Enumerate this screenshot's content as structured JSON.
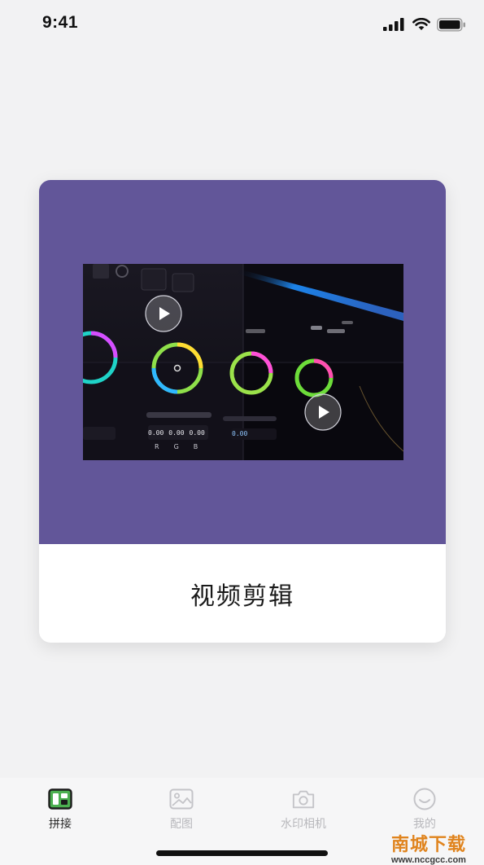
{
  "status_bar": {
    "time": "9:41"
  },
  "card": {
    "title": "视频剪辑",
    "banner_color": "#625699",
    "preview": {
      "wheel_labels": [
        "0.00",
        "0.00",
        "0.00",
        "0.00",
        "R",
        "G",
        "B"
      ]
    }
  },
  "tabs": [
    {
      "label": "拼接",
      "icon": "collage-icon",
      "active": true
    },
    {
      "label": "配图",
      "icon": "image-icon",
      "active": false
    },
    {
      "label": "水印相机",
      "icon": "camera-icon",
      "active": false
    },
    {
      "label": "我的",
      "icon": "smile-face-icon",
      "active": false
    }
  ],
  "watermark": {
    "logo": "南城下载",
    "url": "www.nccgcc.com"
  },
  "colors": {
    "accent_green": "#4caf50",
    "inactive_gray": "#b8b8bc"
  }
}
